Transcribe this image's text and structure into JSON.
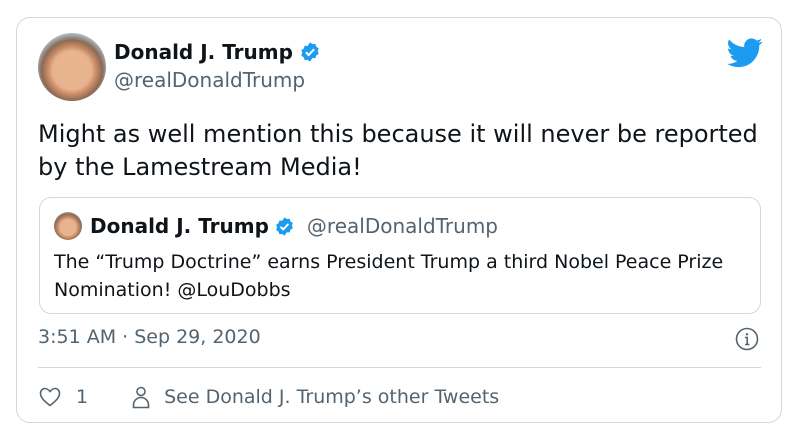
{
  "tweet": {
    "author_name": "Donald J. Trump",
    "author_handle": "@realDonaldTrump",
    "text": "Might as well mention this because it will never be reported by the Lamestream Media!",
    "timestamp": "3:51 AM · Sep 29, 2020",
    "like_count": "1",
    "see_other_label": "See Donald J. Trump’s other Tweets"
  },
  "quoted": {
    "author_name": "Donald J. Trump",
    "author_handle": "@realDonaldTrump",
    "text": "The “Trump Doctrine” earns President Trump a third Nobel Peace Prize Nomination! @LouDobbs"
  },
  "colors": {
    "verified": "#1d9bf0",
    "bird": "#1d9bf0",
    "muted": "#536471"
  }
}
